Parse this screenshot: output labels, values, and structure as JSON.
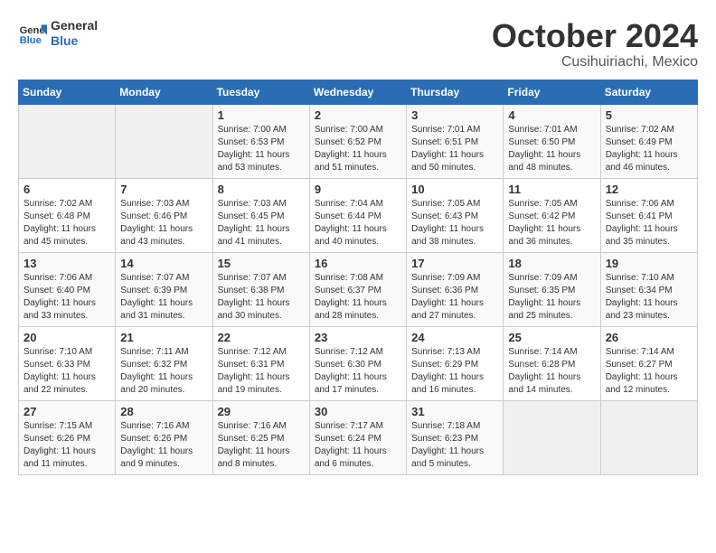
{
  "header": {
    "logo_line1": "General",
    "logo_line2": "Blue",
    "month": "October 2024",
    "location": "Cusihuiriachi, Mexico"
  },
  "weekdays": [
    "Sunday",
    "Monday",
    "Tuesday",
    "Wednesday",
    "Thursday",
    "Friday",
    "Saturday"
  ],
  "weeks": [
    [
      {
        "day": "",
        "sunrise": "",
        "sunset": "",
        "daylight": ""
      },
      {
        "day": "",
        "sunrise": "",
        "sunset": "",
        "daylight": ""
      },
      {
        "day": "1",
        "sunrise": "Sunrise: 7:00 AM",
        "sunset": "Sunset: 6:53 PM",
        "daylight": "Daylight: 11 hours and 53 minutes."
      },
      {
        "day": "2",
        "sunrise": "Sunrise: 7:00 AM",
        "sunset": "Sunset: 6:52 PM",
        "daylight": "Daylight: 11 hours and 51 minutes."
      },
      {
        "day": "3",
        "sunrise": "Sunrise: 7:01 AM",
        "sunset": "Sunset: 6:51 PM",
        "daylight": "Daylight: 11 hours and 50 minutes."
      },
      {
        "day": "4",
        "sunrise": "Sunrise: 7:01 AM",
        "sunset": "Sunset: 6:50 PM",
        "daylight": "Daylight: 11 hours and 48 minutes."
      },
      {
        "day": "5",
        "sunrise": "Sunrise: 7:02 AM",
        "sunset": "Sunset: 6:49 PM",
        "daylight": "Daylight: 11 hours and 46 minutes."
      }
    ],
    [
      {
        "day": "6",
        "sunrise": "Sunrise: 7:02 AM",
        "sunset": "Sunset: 6:48 PM",
        "daylight": "Daylight: 11 hours and 45 minutes."
      },
      {
        "day": "7",
        "sunrise": "Sunrise: 7:03 AM",
        "sunset": "Sunset: 6:46 PM",
        "daylight": "Daylight: 11 hours and 43 minutes."
      },
      {
        "day": "8",
        "sunrise": "Sunrise: 7:03 AM",
        "sunset": "Sunset: 6:45 PM",
        "daylight": "Daylight: 11 hours and 41 minutes."
      },
      {
        "day": "9",
        "sunrise": "Sunrise: 7:04 AM",
        "sunset": "Sunset: 6:44 PM",
        "daylight": "Daylight: 11 hours and 40 minutes."
      },
      {
        "day": "10",
        "sunrise": "Sunrise: 7:05 AM",
        "sunset": "Sunset: 6:43 PM",
        "daylight": "Daylight: 11 hours and 38 minutes."
      },
      {
        "day": "11",
        "sunrise": "Sunrise: 7:05 AM",
        "sunset": "Sunset: 6:42 PM",
        "daylight": "Daylight: 11 hours and 36 minutes."
      },
      {
        "day": "12",
        "sunrise": "Sunrise: 7:06 AM",
        "sunset": "Sunset: 6:41 PM",
        "daylight": "Daylight: 11 hours and 35 minutes."
      }
    ],
    [
      {
        "day": "13",
        "sunrise": "Sunrise: 7:06 AM",
        "sunset": "Sunset: 6:40 PM",
        "daylight": "Daylight: 11 hours and 33 minutes."
      },
      {
        "day": "14",
        "sunrise": "Sunrise: 7:07 AM",
        "sunset": "Sunset: 6:39 PM",
        "daylight": "Daylight: 11 hours and 31 minutes."
      },
      {
        "day": "15",
        "sunrise": "Sunrise: 7:07 AM",
        "sunset": "Sunset: 6:38 PM",
        "daylight": "Daylight: 11 hours and 30 minutes."
      },
      {
        "day": "16",
        "sunrise": "Sunrise: 7:08 AM",
        "sunset": "Sunset: 6:37 PM",
        "daylight": "Daylight: 11 hours and 28 minutes."
      },
      {
        "day": "17",
        "sunrise": "Sunrise: 7:09 AM",
        "sunset": "Sunset: 6:36 PM",
        "daylight": "Daylight: 11 hours and 27 minutes."
      },
      {
        "day": "18",
        "sunrise": "Sunrise: 7:09 AM",
        "sunset": "Sunset: 6:35 PM",
        "daylight": "Daylight: 11 hours and 25 minutes."
      },
      {
        "day": "19",
        "sunrise": "Sunrise: 7:10 AM",
        "sunset": "Sunset: 6:34 PM",
        "daylight": "Daylight: 11 hours and 23 minutes."
      }
    ],
    [
      {
        "day": "20",
        "sunrise": "Sunrise: 7:10 AM",
        "sunset": "Sunset: 6:33 PM",
        "daylight": "Daylight: 11 hours and 22 minutes."
      },
      {
        "day": "21",
        "sunrise": "Sunrise: 7:11 AM",
        "sunset": "Sunset: 6:32 PM",
        "daylight": "Daylight: 11 hours and 20 minutes."
      },
      {
        "day": "22",
        "sunrise": "Sunrise: 7:12 AM",
        "sunset": "Sunset: 6:31 PM",
        "daylight": "Daylight: 11 hours and 19 minutes."
      },
      {
        "day": "23",
        "sunrise": "Sunrise: 7:12 AM",
        "sunset": "Sunset: 6:30 PM",
        "daylight": "Daylight: 11 hours and 17 minutes."
      },
      {
        "day": "24",
        "sunrise": "Sunrise: 7:13 AM",
        "sunset": "Sunset: 6:29 PM",
        "daylight": "Daylight: 11 hours and 16 minutes."
      },
      {
        "day": "25",
        "sunrise": "Sunrise: 7:14 AM",
        "sunset": "Sunset: 6:28 PM",
        "daylight": "Daylight: 11 hours and 14 minutes."
      },
      {
        "day": "26",
        "sunrise": "Sunrise: 7:14 AM",
        "sunset": "Sunset: 6:27 PM",
        "daylight": "Daylight: 11 hours and 12 minutes."
      }
    ],
    [
      {
        "day": "27",
        "sunrise": "Sunrise: 7:15 AM",
        "sunset": "Sunset: 6:26 PM",
        "daylight": "Daylight: 11 hours and 11 minutes."
      },
      {
        "day": "28",
        "sunrise": "Sunrise: 7:16 AM",
        "sunset": "Sunset: 6:26 PM",
        "daylight": "Daylight: 11 hours and 9 minutes."
      },
      {
        "day": "29",
        "sunrise": "Sunrise: 7:16 AM",
        "sunset": "Sunset: 6:25 PM",
        "daylight": "Daylight: 11 hours and 8 minutes."
      },
      {
        "day": "30",
        "sunrise": "Sunrise: 7:17 AM",
        "sunset": "Sunset: 6:24 PM",
        "daylight": "Daylight: 11 hours and 6 minutes."
      },
      {
        "day": "31",
        "sunrise": "Sunrise: 7:18 AM",
        "sunset": "Sunset: 6:23 PM",
        "daylight": "Daylight: 11 hours and 5 minutes."
      },
      {
        "day": "",
        "sunrise": "",
        "sunset": "",
        "daylight": ""
      },
      {
        "day": "",
        "sunrise": "",
        "sunset": "",
        "daylight": ""
      }
    ]
  ]
}
